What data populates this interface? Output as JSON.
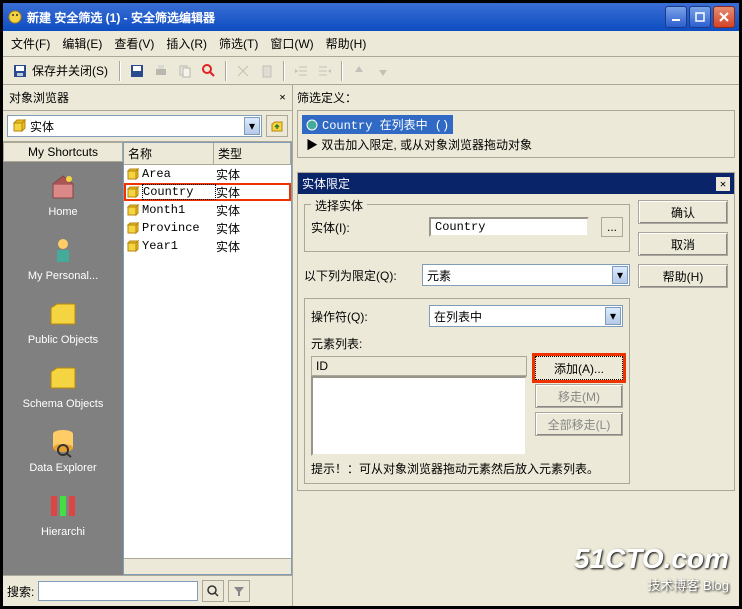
{
  "window": {
    "title": "新建 安全筛选 (1) - 安全筛选编辑器",
    "min": "_",
    "max": "□",
    "close": "X"
  },
  "menu": {
    "file": "文件(F)",
    "edit": "编辑(E)",
    "view": "查看(V)",
    "insert": "插入(R)",
    "filter": "筛选(T)",
    "window": "窗口(W)",
    "help": "帮助(H)"
  },
  "toolbar": {
    "save_close": "保存并关闭(S)"
  },
  "browser": {
    "title": "对象浏览器",
    "dropdown_value": "实体",
    "shortcuts_header": "My Shortcuts",
    "shortcuts": [
      {
        "label": "Home"
      },
      {
        "label": "My Personal..."
      },
      {
        "label": "Public Objects"
      },
      {
        "label": "Schema Objects"
      },
      {
        "label": "Data Explorer"
      },
      {
        "label": "Hierarchi"
      }
    ],
    "cols": {
      "name": "名称",
      "type": "类型"
    },
    "rows": [
      {
        "name": "Area",
        "type": "实体",
        "hl": false
      },
      {
        "name": "Country",
        "type": "实体",
        "hl": true
      },
      {
        "name": "Month1",
        "type": "实体",
        "hl": false
      },
      {
        "name": "Province",
        "type": "实体",
        "hl": false
      },
      {
        "name": "Year1",
        "type": "实体",
        "hl": false
      }
    ]
  },
  "filter_def": {
    "title": "筛选定义：",
    "item": "Country 在列表中 ()",
    "hint": "▶ 双击加入限定, 或从对象浏览器拖动对象"
  },
  "entity": {
    "title": "实体限定",
    "select_label": "选择实体",
    "entity_label": "实体(I):",
    "entity_value": "Country",
    "limit_label": "以下列为限定(Q):",
    "limit_value": "元素",
    "operator_label": "操作符(Q):",
    "operator_value": "在列表中",
    "element_list_label": "元素列表:",
    "id_col": "ID",
    "add_btn": "添加(A)...",
    "remove_btn": "移走(M)",
    "remove_all_btn": "全部移走(L)",
    "hint": "提示！：可从对象浏览器拖动元素然后放入元素列表。",
    "buttons": {
      "ok": "确认",
      "cancel": "取消",
      "help": "帮助(H)"
    }
  },
  "search": {
    "label": "搜索:"
  },
  "watermark": {
    "big": "51CTO.com",
    "small": "技术博客  Blog"
  }
}
